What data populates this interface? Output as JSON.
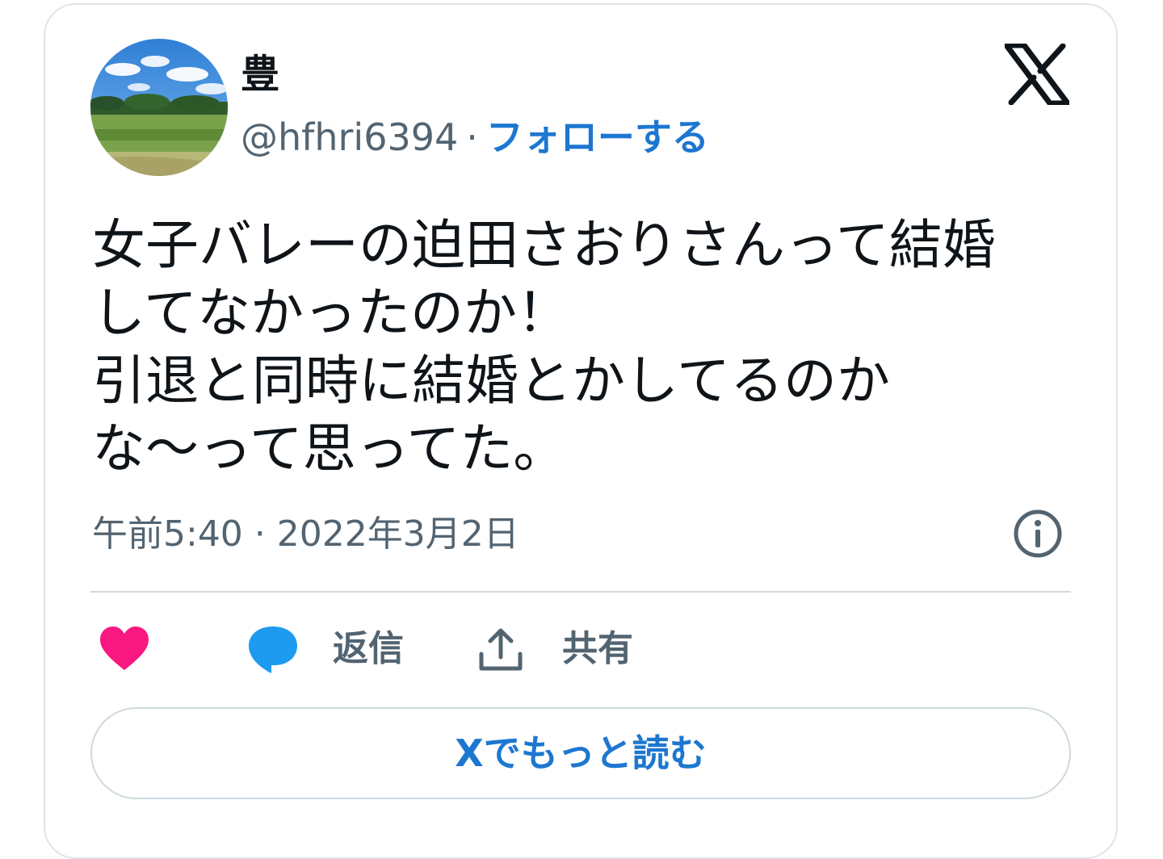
{
  "user": {
    "display_name": "豊",
    "handle": "@hfhri6394",
    "separator": "·",
    "follow_label": "フォローする"
  },
  "tweet": {
    "text": "女子バレーの迫田さおりさんって結婚\nしてなかったのか！\n引退と同時に結婚とかしてるのか\nな〜って思ってた。",
    "timestamp": "午前5:40 · 2022年3月2日"
  },
  "actions": {
    "reply_label": "返信",
    "share_label": "共有"
  },
  "read_more_label": "Xでもっと読む",
  "icons": {
    "brand": "x-logo-icon",
    "info": "info-icon",
    "like": "heart-icon",
    "reply": "speech-bubble-icon",
    "share": "upload-arrow-icon"
  },
  "colors": {
    "link": "#1d77d0",
    "heart": "#f91880",
    "reply_bubble": "#1d9bf0",
    "text": "#0f1419",
    "secondary_text": "#536471",
    "border": "#cfd9de"
  }
}
